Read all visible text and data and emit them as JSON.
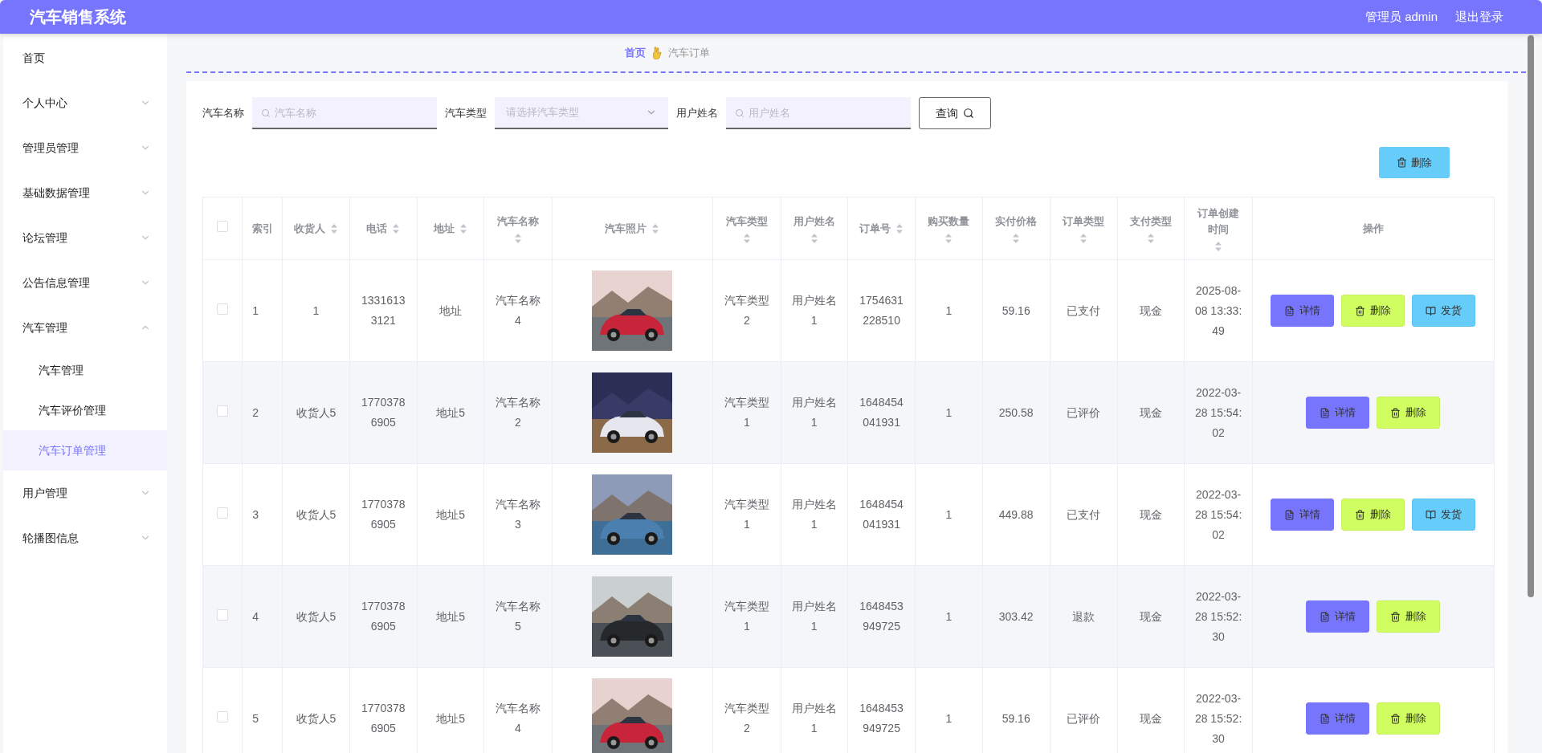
{
  "header": {
    "title": "汽车销售系统",
    "user": "管理员 admin",
    "logout": "退出登录"
  },
  "sidebar": {
    "items": [
      {
        "label": "首页",
        "selected": false
      },
      {
        "label": "个人中心",
        "selected": false,
        "expanded": false
      },
      {
        "label": "管理员管理",
        "selected": false,
        "expanded": false
      },
      {
        "label": "基础数据管理",
        "selected": false,
        "expanded": false
      },
      {
        "label": "论坛管理",
        "selected": false,
        "expanded": false
      },
      {
        "label": "公告信息管理",
        "selected": false,
        "expanded": false
      },
      {
        "label": "汽车管理",
        "selected": false,
        "expanded": true,
        "children": [
          {
            "label": "汽车管理",
            "selected": false
          },
          {
            "label": "汽车评价管理",
            "selected": false
          },
          {
            "label": "汽车订单管理",
            "selected": true
          }
        ]
      },
      {
        "label": "用户管理",
        "selected": false,
        "expanded": false
      },
      {
        "label": "轮播图信息",
        "selected": false,
        "expanded": false
      }
    ]
  },
  "breadcrumb": [
    "首页",
    "汽车订单"
  ],
  "search": {
    "fields": [
      {
        "kind": "input",
        "label": "汽车名称",
        "placeholder": "汽车名称"
      },
      {
        "kind": "select",
        "label": "汽车类型",
        "placeholder": "请选择汽车类型"
      },
      {
        "kind": "input",
        "label": "用户姓名",
        "placeholder": "用户姓名"
      }
    ],
    "button": "查询"
  },
  "bulk_delete": "删除",
  "table": {
    "columns": [
      {
        "kind": "checkbox",
        "checked": false
      },
      {
        "kind": "text",
        "label": "索引",
        "sortable": false
      },
      {
        "kind": "text",
        "label": "收货人",
        "sortable": true
      },
      {
        "kind": "text",
        "label": "电话",
        "sortable": true
      },
      {
        "kind": "text",
        "label": "地址",
        "sortable": true
      },
      {
        "kind": "text",
        "label": "汽车名称",
        "sortable": true
      },
      {
        "label": "汽车照片",
        "sortable": true
      },
      {
        "kind": "text",
        "label": "汽车类型",
        "sortable": true
      },
      {
        "kind": "text",
        "label": "用户姓名",
        "sortable": true
      },
      {
        "kind": "text",
        "label": "订单号",
        "sortable": true
      },
      {
        "kind": "text",
        "label": "购买数量",
        "sortable": true
      },
      {
        "kind": "text",
        "label": "实付价格",
        "sortable": true
      },
      {
        "kind": "text",
        "label": "订单类型",
        "sortable": true
      },
      {
        "kind": "text",
        "label": "支付类型",
        "sortable": true
      },
      {
        "kind": "text",
        "label": "订单创建时间",
        "sortable": true
      },
      {
        "kind": "actions",
        "label": "操作",
        "sortable": false
      }
    ],
    "rows": [
      {
        "cells": [
          {
            "checked": false
          },
          "1",
          "1",
          "13316133121",
          "地址",
          "汽车名称4",
          {
            "kind": "picture"
          },
          "汽车类型2",
          "用户姓名1",
          "1754631228510",
          "1",
          "59.16",
          "已支付",
          "现金",
          "2025-08-08 13:33:49",
          [
            {
              "kind": "detail",
              "label": "详情"
            },
            {
              "kind": "delete",
              "label": "删除"
            },
            {
              "kind": "ship",
              "label": "发货"
            }
          ]
        ]
      },
      {
        "cells": [
          {
            "checked": false
          },
          "2",
          "收货人5",
          "17703786905",
          "地址5",
          "汽车名称2",
          {
            "kind": "picture"
          },
          "汽车类型1",
          "用户姓名1",
          "1648454041931",
          "1",
          "250.58",
          "已评价",
          "现金",
          "2022-03-28 15:54:02",
          [
            {
              "kind": "detail",
              "label": "详情"
            },
            {
              "kind": "delete",
              "label": "删除"
            }
          ]
        ]
      },
      {
        "cells": [
          {
            "checked": false
          },
          "3",
          "收货人5",
          "17703786905",
          "地址5",
          "汽车名称3",
          {
            "kind": "picture"
          },
          "汽车类型1",
          "用户姓名1",
          "1648454041931",
          "1",
          "449.88",
          "已支付",
          "现金",
          "2022-03-28 15:54:02",
          [
            {
              "kind": "detail",
              "label": "详情"
            },
            {
              "kind": "delete",
              "label": "删除"
            },
            {
              "kind": "ship",
              "label": "发货"
            }
          ]
        ]
      },
      {
        "cells": [
          {
            "checked": false
          },
          "4",
          "收货人5",
          "17703786905",
          "地址5",
          "汽车名称5",
          {
            "kind": "picture"
          },
          "汽车类型1",
          "用户姓名1",
          "1648453949725",
          "1",
          "303.42",
          "退款",
          "现金",
          "2022-03-28 15:52:30",
          [
            {
              "kind": "detail",
              "label": "详情"
            },
            {
              "kind": "delete",
              "label": "删除"
            }
          ]
        ]
      },
      {
        "cells": [
          {
            "checked": false
          },
          "5",
          "收货人5",
          "17703786905",
          "地址5",
          "汽车名称4",
          {
            "kind": "picture"
          },
          "汽车类型2",
          "用户姓名1",
          "1648453949725",
          "1",
          "59.16",
          "已评价",
          "现金",
          "2022-03-28 15:52:30",
          [
            {
              "kind": "detail",
              "label": "详情"
            },
            {
              "kind": "delete",
              "label": "删除"
            }
          ]
        ]
      }
    ]
  }
}
